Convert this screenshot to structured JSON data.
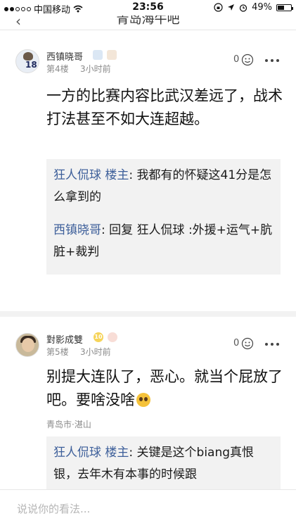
{
  "status_bar": {
    "carrier": "中国移动",
    "time": "23:56",
    "battery": "49%",
    "battery_level": 0.49
  },
  "nav": {
    "title": "青岛海牛吧"
  },
  "posts": [
    {
      "username": "西镇晓哥",
      "floor": "第4楼",
      "time_ago": "3小时前",
      "like_count": "0",
      "content": "一方的比赛内容比武汉差远了，战术打法甚至不如大连超越。",
      "replies": [
        {
          "author": "狂人侃球 楼主",
          "text": ": 我都有的怀疑这41分是怎么拿到的"
        },
        {
          "author": "西镇晓哥",
          "text": ": 回复 狂人侃球 :外援+运气+肮脏+裁判"
        }
      ]
    },
    {
      "username": "對影成雙",
      "level": "10",
      "floor": "第5楼",
      "time_ago": "3小时前",
      "like_count": "0",
      "content": "别提大连队了，恶心。就当个屁放了吧。要啥没啥",
      "location": "青岛市·湛山",
      "replies": [
        {
          "author": "狂人侃球 楼主",
          "text": ": 关键是这个biang真恨银，去年木有本事的时候跟"
        }
      ]
    }
  ],
  "input": {
    "placeholder": "说说你的看法..."
  },
  "colors": {
    "author_link": "#3d5f9a",
    "reply_bg": "#f2f2f2",
    "meta_text": "#8a8a8a"
  }
}
